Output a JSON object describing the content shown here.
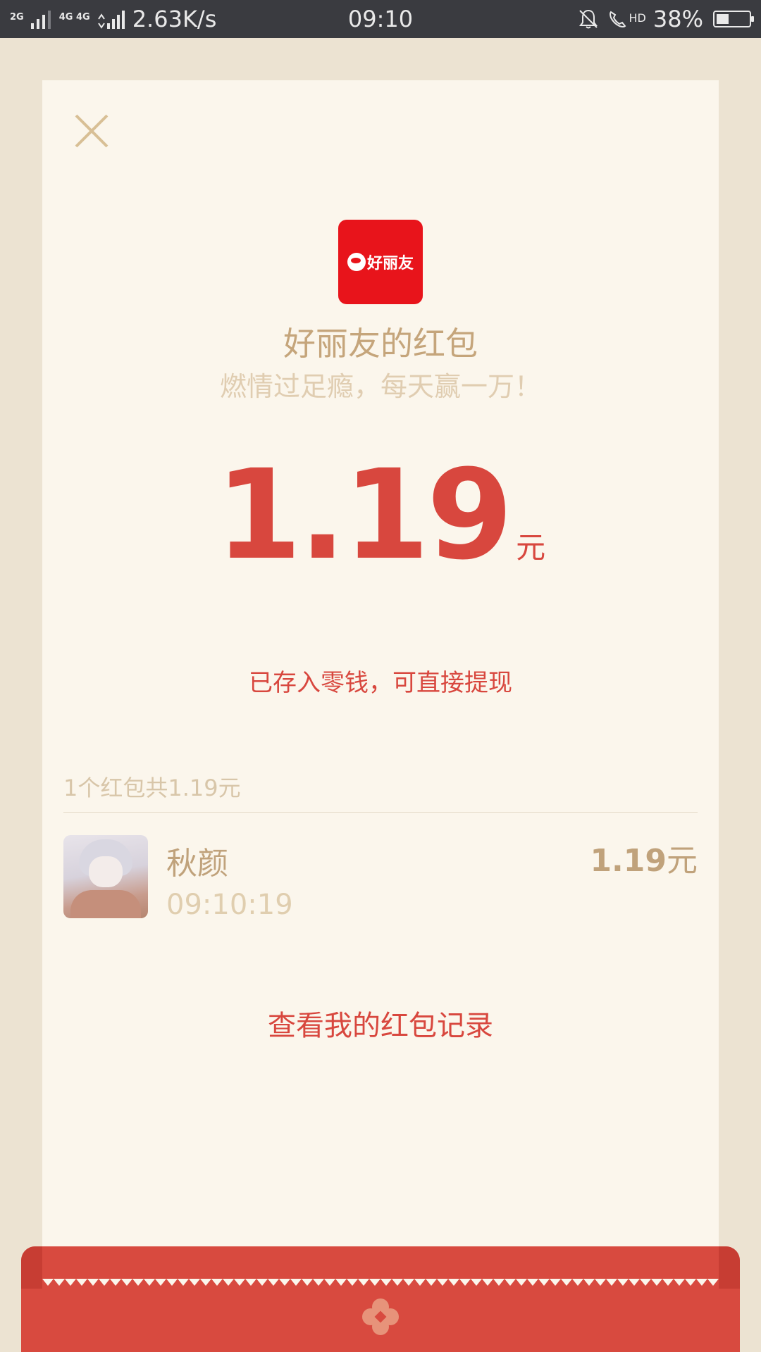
{
  "status_bar": {
    "network_small_1": "2G",
    "network_small_2": "4G 4G",
    "speed": "2.63K/s",
    "time": "09:10",
    "hd": "HD",
    "battery": "38%",
    "battery_level": 0.38
  },
  "envelope": {
    "logo_text": "好丽友",
    "title": "好丽友的红包",
    "subtitle": "燃情过足瘾，每天赢一万！",
    "amount": "1.19",
    "unit": "元",
    "deposit_note": "已存入零钱，可直接提现",
    "summary": "1个红包共1.19元",
    "recipients": [
      {
        "name": "秋颜",
        "time": "09:10:19",
        "amount": "1.19",
        "unit": "元"
      }
    ],
    "records_link": "查看我的红包记录"
  },
  "colors": {
    "accent_red": "#d8473e",
    "gold": "#c5a57b",
    "card_bg": "#fbf6ec",
    "page_bg": "#ece3d2",
    "logo_red": "#e8141b"
  }
}
